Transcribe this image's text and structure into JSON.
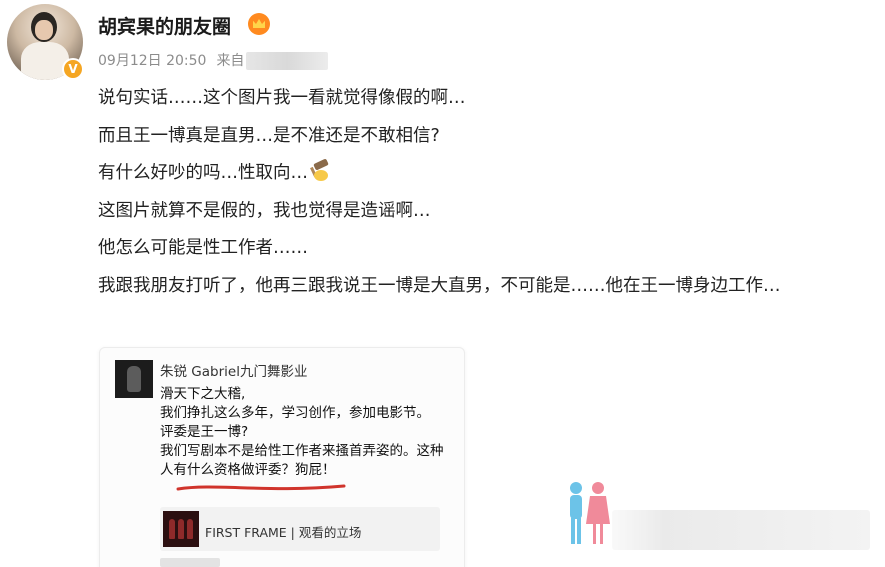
{
  "author": {
    "name": "胡宾果的朋友圈",
    "verified_badge": "V",
    "badge_color": "#f5a623"
  },
  "meta": {
    "timestamp": "09月12日 20:50",
    "source_prefix": "来自"
  },
  "post": {
    "lines": [
      "说句实话……这个图片我一看就觉得像假的啊…",
      "而且王一博真是直男…是不准还是不敢相信?",
      "有什么好吵的吗…性取向…",
      "这图片就算不是假的，我也觉得是造谣啊…",
      "他怎么可能是性工作者……",
      "我跟我朋友打听了，他再三跟我说王一博是大直男，不可能是……他在王一博身边工作…"
    ]
  },
  "embedded_post": {
    "author": "朱锐 Gabriel九门舞影业",
    "lines": [
      "滑天下之大稽,",
      "我们挣扎这么多年，学习创作，参加电影节。",
      "评委是王一博?",
      "我们写剧本不是给性工作者来搔首弄姿的。这种人有什么资格做评委？狗屁！"
    ],
    "link_title": "FIRST FRAME | 观看的立场"
  },
  "colors": {
    "text": "#222222",
    "meta": "#8c8c8c",
    "accent_orange": "#ff8a1f",
    "underline_red": "#d0342c"
  }
}
